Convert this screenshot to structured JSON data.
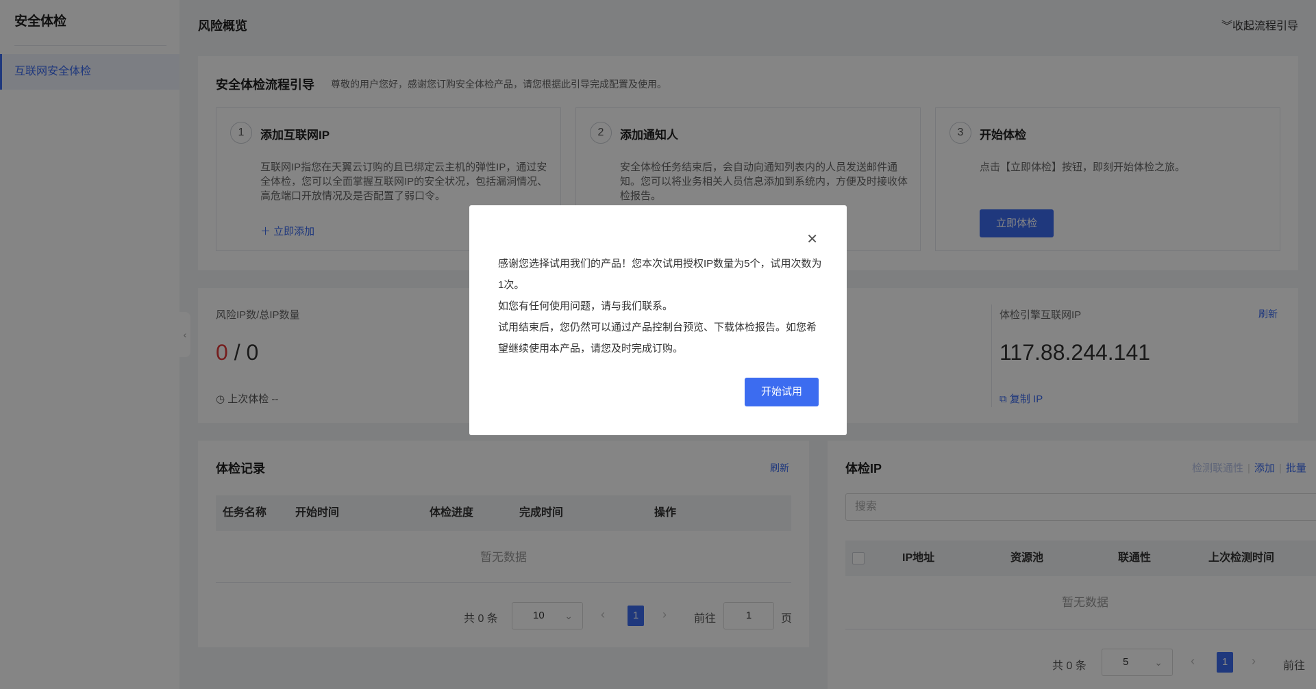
{
  "sidebar": {
    "title": "安全体检",
    "items": [
      {
        "label": "互联网安全体检"
      }
    ],
    "collapse_icon": "chevron-left-icon"
  },
  "header": {
    "title": "风险概览",
    "collapse_guide": "︾收起流程引导"
  },
  "guide": {
    "title": "安全体检流程引导",
    "desc": "尊敬的用户您好，感谢您订购安全体检产品，请您根据此引导完成配置及使用。",
    "steps": [
      {
        "num": "1",
        "title": "添加互联网IP",
        "text": "互联网IP指您在天翼云订购的且已绑定云主机的弹性IP，通过安全体检，您可以全面掌握互联网IP的安全状况，包括漏洞情况、高危端口开放情况及是否配置了弱口令。",
        "link": "＋ 立即添加"
      },
      {
        "num": "2",
        "title": "添加通知人",
        "text": "安全体检任务结束后，会自动向通知列表内的人员发送邮件通知。您可以将业务相关人员信息添加到系统内，方便及时接收体检报告。"
      },
      {
        "num": "3",
        "title": "开始体检",
        "text": "点击【立即体检】按钮，即刻开始体检之旅。",
        "button": "立即体检"
      }
    ]
  },
  "stats": {
    "risk_label": "风险IP数/总IP数量",
    "risk_count": "0",
    "total_sep": " / 0",
    "last_check": "上次体检 --",
    "engine_label": "体检引擎互联网IP",
    "refresh": "刷新",
    "engine_ip": "117.88.244.141",
    "copy_ip": "复制 IP"
  },
  "records": {
    "title": "体检记录",
    "refresh": "刷新",
    "columns": [
      "任务名称",
      "开始时间",
      "体检进度",
      "完成时间",
      "操作"
    ],
    "empty": "暂无数据",
    "pager": {
      "total": "共 0 条",
      "page_size": "10",
      "page": "1",
      "goto": "前往",
      "goto_value": "1",
      "page_unit": "页"
    }
  },
  "ip": {
    "title": "体检IP",
    "actions": [
      "检测联通性",
      "添加",
      "批量"
    ],
    "search_placeholder": "搜索",
    "columns": [
      "IP地址",
      "资源池",
      "联通性",
      "上次检测时间"
    ],
    "empty": "暂无数据",
    "pager": {
      "total": "共 0 条",
      "page_size": "5",
      "page": "1",
      "goto": "前往"
    }
  },
  "modal": {
    "lines": [
      "感谢您选择试用我们的产品！您本次试用授权IP数量为5个，试用次数为1次。",
      "如您有任何使用问题，请与我们联系。",
      "试用结束后，您仍然可以通过产品控制台预览、下载体检报告。如您希望继续使用本产品，请您及时完成订购。"
    ],
    "button": "开始试用"
  },
  "colors": {
    "accent": "#3c6cf0",
    "danger": "#e03a3a"
  }
}
